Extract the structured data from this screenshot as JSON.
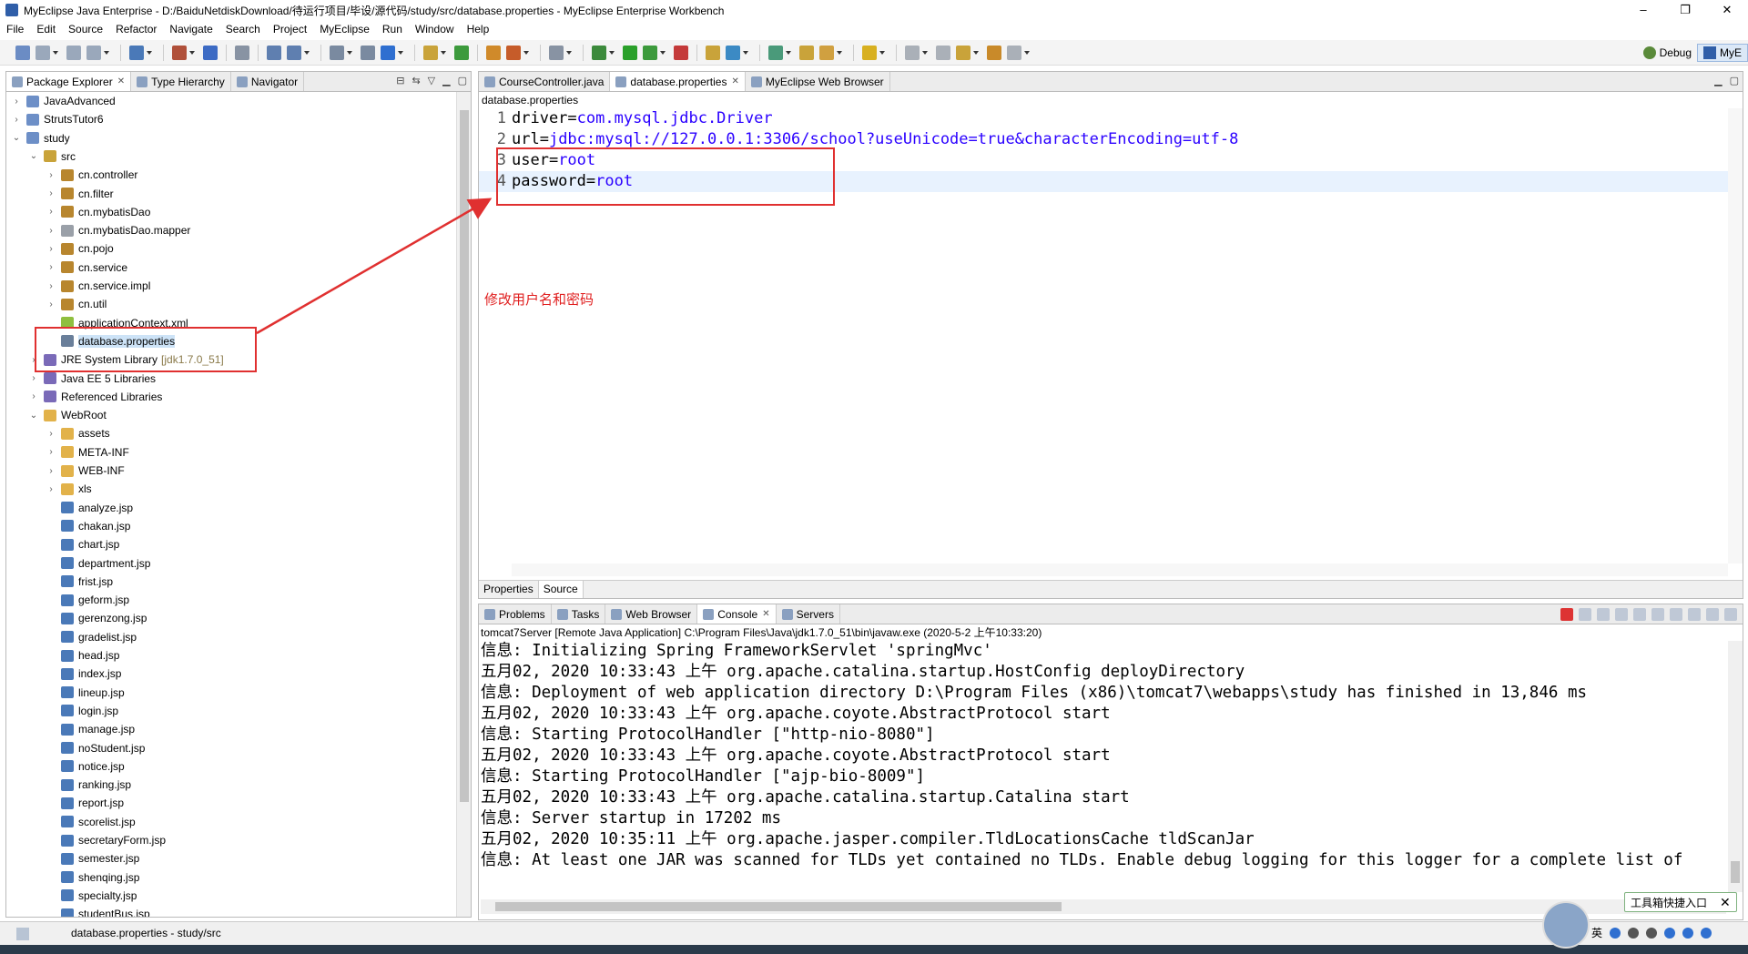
{
  "window": {
    "title": "MyEclipse Java Enterprise - D:/BaiduNetdiskDownload/待运行项目/毕设/源代码/study/src/database.properties - MyEclipse Enterprise Workbench"
  },
  "menu": [
    "File",
    "Edit",
    "Source",
    "Refactor",
    "Navigate",
    "Search",
    "Project",
    "MyEclipse",
    "Run",
    "Window",
    "Help"
  ],
  "perspectives": {
    "debug": "Debug",
    "myeclipse": "MyE"
  },
  "left_tabs": [
    {
      "label": "Package Explorer",
      "active": true
    },
    {
      "label": "Type Hierarchy"
    },
    {
      "label": "Navigator"
    }
  ],
  "tree": [
    {
      "label": "JavaAdvanced",
      "level": 0,
      "twisty": "›",
      "icon": "project"
    },
    {
      "label": "StrutsTutor6",
      "level": 0,
      "twisty": "›",
      "icon": "project"
    },
    {
      "label": "study",
      "level": 0,
      "twisty": "⌄",
      "icon": "project"
    },
    {
      "label": "src",
      "level": 1,
      "twisty": "⌄",
      "icon": "source-folder"
    },
    {
      "label": "cn.controller",
      "level": 2,
      "twisty": "›",
      "icon": "package"
    },
    {
      "label": "cn.filter",
      "level": 2,
      "twisty": "›",
      "icon": "package"
    },
    {
      "label": "cn.mybatisDao",
      "level": 2,
      "twisty": "›",
      "icon": "package"
    },
    {
      "label": "cn.mybatisDao.mapper",
      "level": 2,
      "twisty": "›",
      "icon": "package-empty"
    },
    {
      "label": "cn.pojo",
      "level": 2,
      "twisty": "›",
      "icon": "package"
    },
    {
      "label": "cn.service",
      "level": 2,
      "twisty": "›",
      "icon": "package"
    },
    {
      "label": "cn.service.impl",
      "level": 2,
      "twisty": "›",
      "icon": "package"
    },
    {
      "label": "cn.util",
      "level": 2,
      "twisty": "›",
      "icon": "package"
    },
    {
      "label": "applicationContext.xml",
      "level": 2,
      "twisty": "",
      "icon": "xml"
    },
    {
      "label": "database.properties",
      "level": 2,
      "twisty": "",
      "icon": "properties",
      "selected": true
    },
    {
      "label": "JRE System Library",
      "level": 1,
      "twisty": "›",
      "icon": "library",
      "extra": "[jdk1.7.0_51]"
    },
    {
      "label": "Java EE 5 Libraries",
      "level": 1,
      "twisty": "›",
      "icon": "library"
    },
    {
      "label": "Referenced Libraries",
      "level": 1,
      "twisty": "›",
      "icon": "library"
    },
    {
      "label": "WebRoot",
      "level": 1,
      "twisty": "⌄",
      "icon": "folder"
    },
    {
      "label": "assets",
      "level": 2,
      "twisty": "›",
      "icon": "folder"
    },
    {
      "label": "META-INF",
      "level": 2,
      "twisty": "›",
      "icon": "folder"
    },
    {
      "label": "WEB-INF",
      "level": 2,
      "twisty": "›",
      "icon": "folder"
    },
    {
      "label": "xls",
      "level": 2,
      "twisty": "›",
      "icon": "folder"
    },
    {
      "label": "analyze.jsp",
      "level": 2,
      "twisty": "",
      "icon": "jsp"
    },
    {
      "label": "chakan.jsp",
      "level": 2,
      "twisty": "",
      "icon": "jsp"
    },
    {
      "label": "chart.jsp",
      "level": 2,
      "twisty": "",
      "icon": "jsp"
    },
    {
      "label": "department.jsp",
      "level": 2,
      "twisty": "",
      "icon": "jsp"
    },
    {
      "label": "frist.jsp",
      "level": 2,
      "twisty": "",
      "icon": "jsp"
    },
    {
      "label": "geform.jsp",
      "level": 2,
      "twisty": "",
      "icon": "jsp"
    },
    {
      "label": "gerenzong.jsp",
      "level": 2,
      "twisty": "",
      "icon": "jsp"
    },
    {
      "label": "gradelist.jsp",
      "level": 2,
      "twisty": "",
      "icon": "jsp"
    },
    {
      "label": "head.jsp",
      "level": 2,
      "twisty": "",
      "icon": "jsp"
    },
    {
      "label": "index.jsp",
      "level": 2,
      "twisty": "",
      "icon": "jsp"
    },
    {
      "label": "lineup.jsp",
      "level": 2,
      "twisty": "",
      "icon": "jsp"
    },
    {
      "label": "login.jsp",
      "level": 2,
      "twisty": "",
      "icon": "jsp"
    },
    {
      "label": "manage.jsp",
      "level": 2,
      "twisty": "",
      "icon": "jsp"
    },
    {
      "label": "noStudent.jsp",
      "level": 2,
      "twisty": "",
      "icon": "jsp"
    },
    {
      "label": "notice.jsp",
      "level": 2,
      "twisty": "",
      "icon": "jsp"
    },
    {
      "label": "ranking.jsp",
      "level": 2,
      "twisty": "",
      "icon": "jsp"
    },
    {
      "label": "report.jsp",
      "level": 2,
      "twisty": "",
      "icon": "jsp"
    },
    {
      "label": "scorelist.jsp",
      "level": 2,
      "twisty": "",
      "icon": "jsp"
    },
    {
      "label": "secretaryForm.jsp",
      "level": 2,
      "twisty": "",
      "icon": "jsp"
    },
    {
      "label": "semester.jsp",
      "level": 2,
      "twisty": "",
      "icon": "jsp"
    },
    {
      "label": "shenqing.jsp",
      "level": 2,
      "twisty": "",
      "icon": "jsp"
    },
    {
      "label": "specialty.jsp",
      "level": 2,
      "twisty": "",
      "icon": "jsp"
    },
    {
      "label": "studentBus.jsp",
      "level": 2,
      "twisty": "",
      "icon": "jsp"
    }
  ],
  "editor_tabs": [
    {
      "label": "CourseController.java"
    },
    {
      "label": "database.properties",
      "active": true
    },
    {
      "label": "MyEclipse Web Browser"
    }
  ],
  "editor": {
    "breadcrumb": "database.properties",
    "lines": [
      {
        "num": "1",
        "key": "driver=",
        "value": "com.mysql.jdbc.Driver"
      },
      {
        "num": "2",
        "key": "url=",
        "value": "jdbc:mysql://127.0.0.1:3306/school?useUnicode=true&characterEncoding=utf-8"
      },
      {
        "num": "3",
        "key": "user=",
        "value": "root"
      },
      {
        "num": "4",
        "key": "password=",
        "value": "root"
      }
    ],
    "bottom_tabs": [
      "Properties",
      "Source"
    ]
  },
  "annotation": {
    "text": "修改用户名和密码",
    "color": "#e02020"
  },
  "console_tabs": [
    {
      "label": "Problems"
    },
    {
      "label": "Tasks"
    },
    {
      "label": "Web Browser"
    },
    {
      "label": "Console",
      "active": true
    },
    {
      "label": "Servers"
    }
  ],
  "console": {
    "title": "tomcat7Server [Remote Java Application] C:\\Program Files\\Java\\jdk1.7.0_51\\bin\\javaw.exe (2020-5-2 上午10:33:20)",
    "lines": [
      "信息: Initializing Spring FrameworkServlet 'springMvc'",
      "五月02, 2020 10:33:43 上午 org.apache.catalina.startup.HostConfig deployDirectory",
      "信息: Deployment of web application directory D:\\Program Files (x86)\\tomcat7\\webapps\\study has finished in 13,846 ms",
      "五月02, 2020 10:33:43 上午 org.apache.coyote.AbstractProtocol start",
      "信息: Starting ProtocolHandler [\"http-nio-8080\"]",
      "五月02, 2020 10:33:43 上午 org.apache.coyote.AbstractProtocol start",
      "信息: Starting ProtocolHandler [\"ajp-bio-8009\"]",
      "五月02, 2020 10:33:43 上午 org.apache.catalina.startup.Catalina start",
      "信息: Server startup in 17202 ms",
      "五月02, 2020 10:35:11 上午 org.apache.jasper.compiler.TldLocationsCache tldScanJar",
      "信息: At least one JAR was scanned for TLDs yet contained no TLDs. Enable debug logging for this logger for a complete list of"
    ]
  },
  "status": {
    "text": "database.properties - study/src"
  },
  "tooltip": {
    "text": "工具箱快捷入口"
  },
  "tray": {
    "ime": "英"
  },
  "icon_colors": {
    "project": "#6d8fc7",
    "source-folder": "#c9a33a",
    "package": "#b8862e",
    "package-empty": "#9aa0a8",
    "xml": "#8fbf3f",
    "properties": "#6a7f9a",
    "library": "#7a6ab8",
    "folder": "#e2b24a",
    "jsp": "#4a79b8"
  }
}
